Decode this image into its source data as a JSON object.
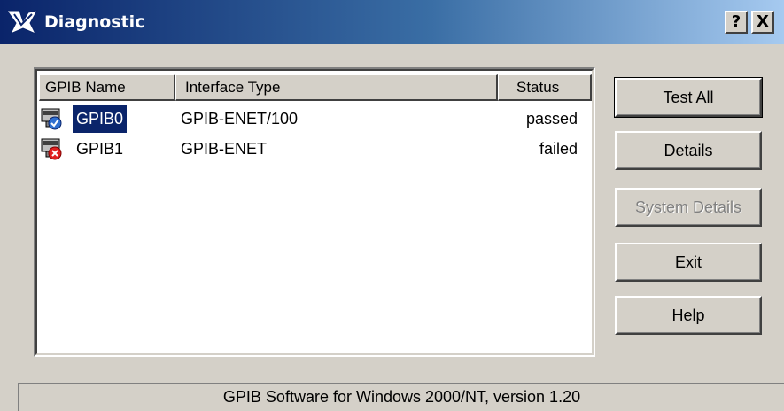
{
  "window": {
    "title": "Diagnostic",
    "help_glyph": "?",
    "close_glyph": "X"
  },
  "list": {
    "columns": [
      "GPIB Name",
      "Interface Type",
      "Status"
    ],
    "rows": [
      {
        "name": "GPIB0",
        "type": "GPIB-ENET/100",
        "status": "passed",
        "icon": "gpib-passed-icon",
        "selected": true
      },
      {
        "name": "GPIB1",
        "type": "GPIB-ENET",
        "status": "failed",
        "icon": "gpib-failed-icon",
        "selected": false
      }
    ]
  },
  "buttons": {
    "test_all": "Test All",
    "details": "Details",
    "system_details": "System Details",
    "exit": "Exit",
    "help": "Help"
  },
  "status_bar": {
    "text": "GPIB Software for Windows 2000/NT, version 1.20"
  },
  "colors": {
    "titlebar_start": "#0a246a",
    "titlebar_end": "#a6caf0",
    "face": "#d4d0c8",
    "selection": "#0a246a",
    "disabled_text": "#808080"
  }
}
